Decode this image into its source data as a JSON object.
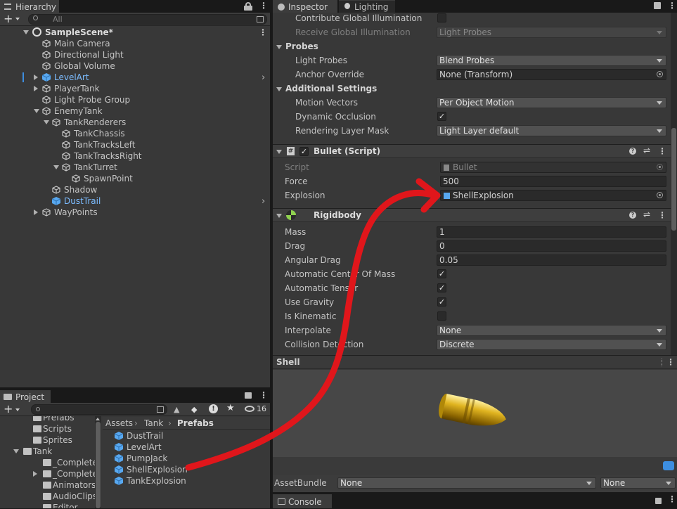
{
  "hierarchy": {
    "tab_label": "Hierarchy",
    "search_placeholder": "All",
    "scene_name": "SampleScene*",
    "items": [
      {
        "label": "Main Camera"
      },
      {
        "label": "Directional Light"
      },
      {
        "label": "Global Volume"
      },
      {
        "label": "LevelArt"
      },
      {
        "label": "PlayerTank"
      },
      {
        "label": "Light Probe Group"
      },
      {
        "label": "EnemyTank"
      },
      {
        "label": "TankRenderers"
      },
      {
        "label": "TankChassis"
      },
      {
        "label": "TankTracksLeft"
      },
      {
        "label": "TankTracksRight"
      },
      {
        "label": "TankTurret"
      },
      {
        "label": "SpawnPoint"
      },
      {
        "label": "Shadow"
      },
      {
        "label": "DustTrail"
      },
      {
        "label": "WayPoints"
      }
    ]
  },
  "project": {
    "tab_label": "Project",
    "hidden_count": "16",
    "folders": [
      "Prefabs",
      "Scripts",
      "Sprites",
      "Tank",
      "_Complete-G",
      "_Completed-",
      "Animators",
      "AudioClips",
      "Editor"
    ],
    "breadcrumb": [
      "Assets",
      "Tank",
      "Prefabs"
    ],
    "assets": [
      "DustTrail",
      "LevelArt",
      "PumpJack",
      "ShellExplosion",
      "TankExplosion"
    ]
  },
  "inspector": {
    "tabs": [
      "Inspector",
      "Lighting"
    ],
    "mesh_renderer": {
      "contribute_gi_label": "Contribute Global Illumination",
      "receive_gi_label": "Receive Global Illumination",
      "receive_gi_value": "Light Probes",
      "probes_header": "Probes",
      "light_probes_label": "Light Probes",
      "light_probes_value": "Blend Probes",
      "anchor_override_label": "Anchor Override",
      "anchor_override_value": "None (Transform)",
      "additional_header": "Additional Settings",
      "motion_vectors_label": "Motion Vectors",
      "motion_vectors_value": "Per Object Motion",
      "dynamic_occlusion_label": "Dynamic Occlusion",
      "rendering_layer_label": "Rendering Layer Mask",
      "rendering_layer_value": "Light Layer default"
    },
    "bullet": {
      "title": "Bullet (Script)",
      "script_label": "Script",
      "script_value": "Bullet",
      "force_label": "Force",
      "force_value": "500",
      "explosion_label": "Explosion",
      "explosion_value": "ShellExplosion"
    },
    "rigidbody": {
      "title": "Rigidbody",
      "mass_label": "Mass",
      "mass_value": "1",
      "drag_label": "Drag",
      "drag_value": "0",
      "angular_drag_label": "Angular Drag",
      "angular_drag_value": "0.05",
      "auto_com_label": "Automatic Center Of Mass",
      "auto_tensor_label": "Automatic Tensor",
      "use_gravity_label": "Use Gravity",
      "is_kinematic_label": "Is Kinematic",
      "interpolate_label": "Interpolate",
      "interpolate_value": "None",
      "collision_label": "Collision Detection",
      "collision_value": "Discrete"
    },
    "preview": {
      "title": "Shell"
    },
    "assetbundle": {
      "label": "AssetBundle",
      "value": "None",
      "variant": "None"
    }
  },
  "console": {
    "tab_label": "Console"
  },
  "colors": {
    "annotation_arrow": "#e0161b",
    "selection_blue": "#7cbcff"
  }
}
